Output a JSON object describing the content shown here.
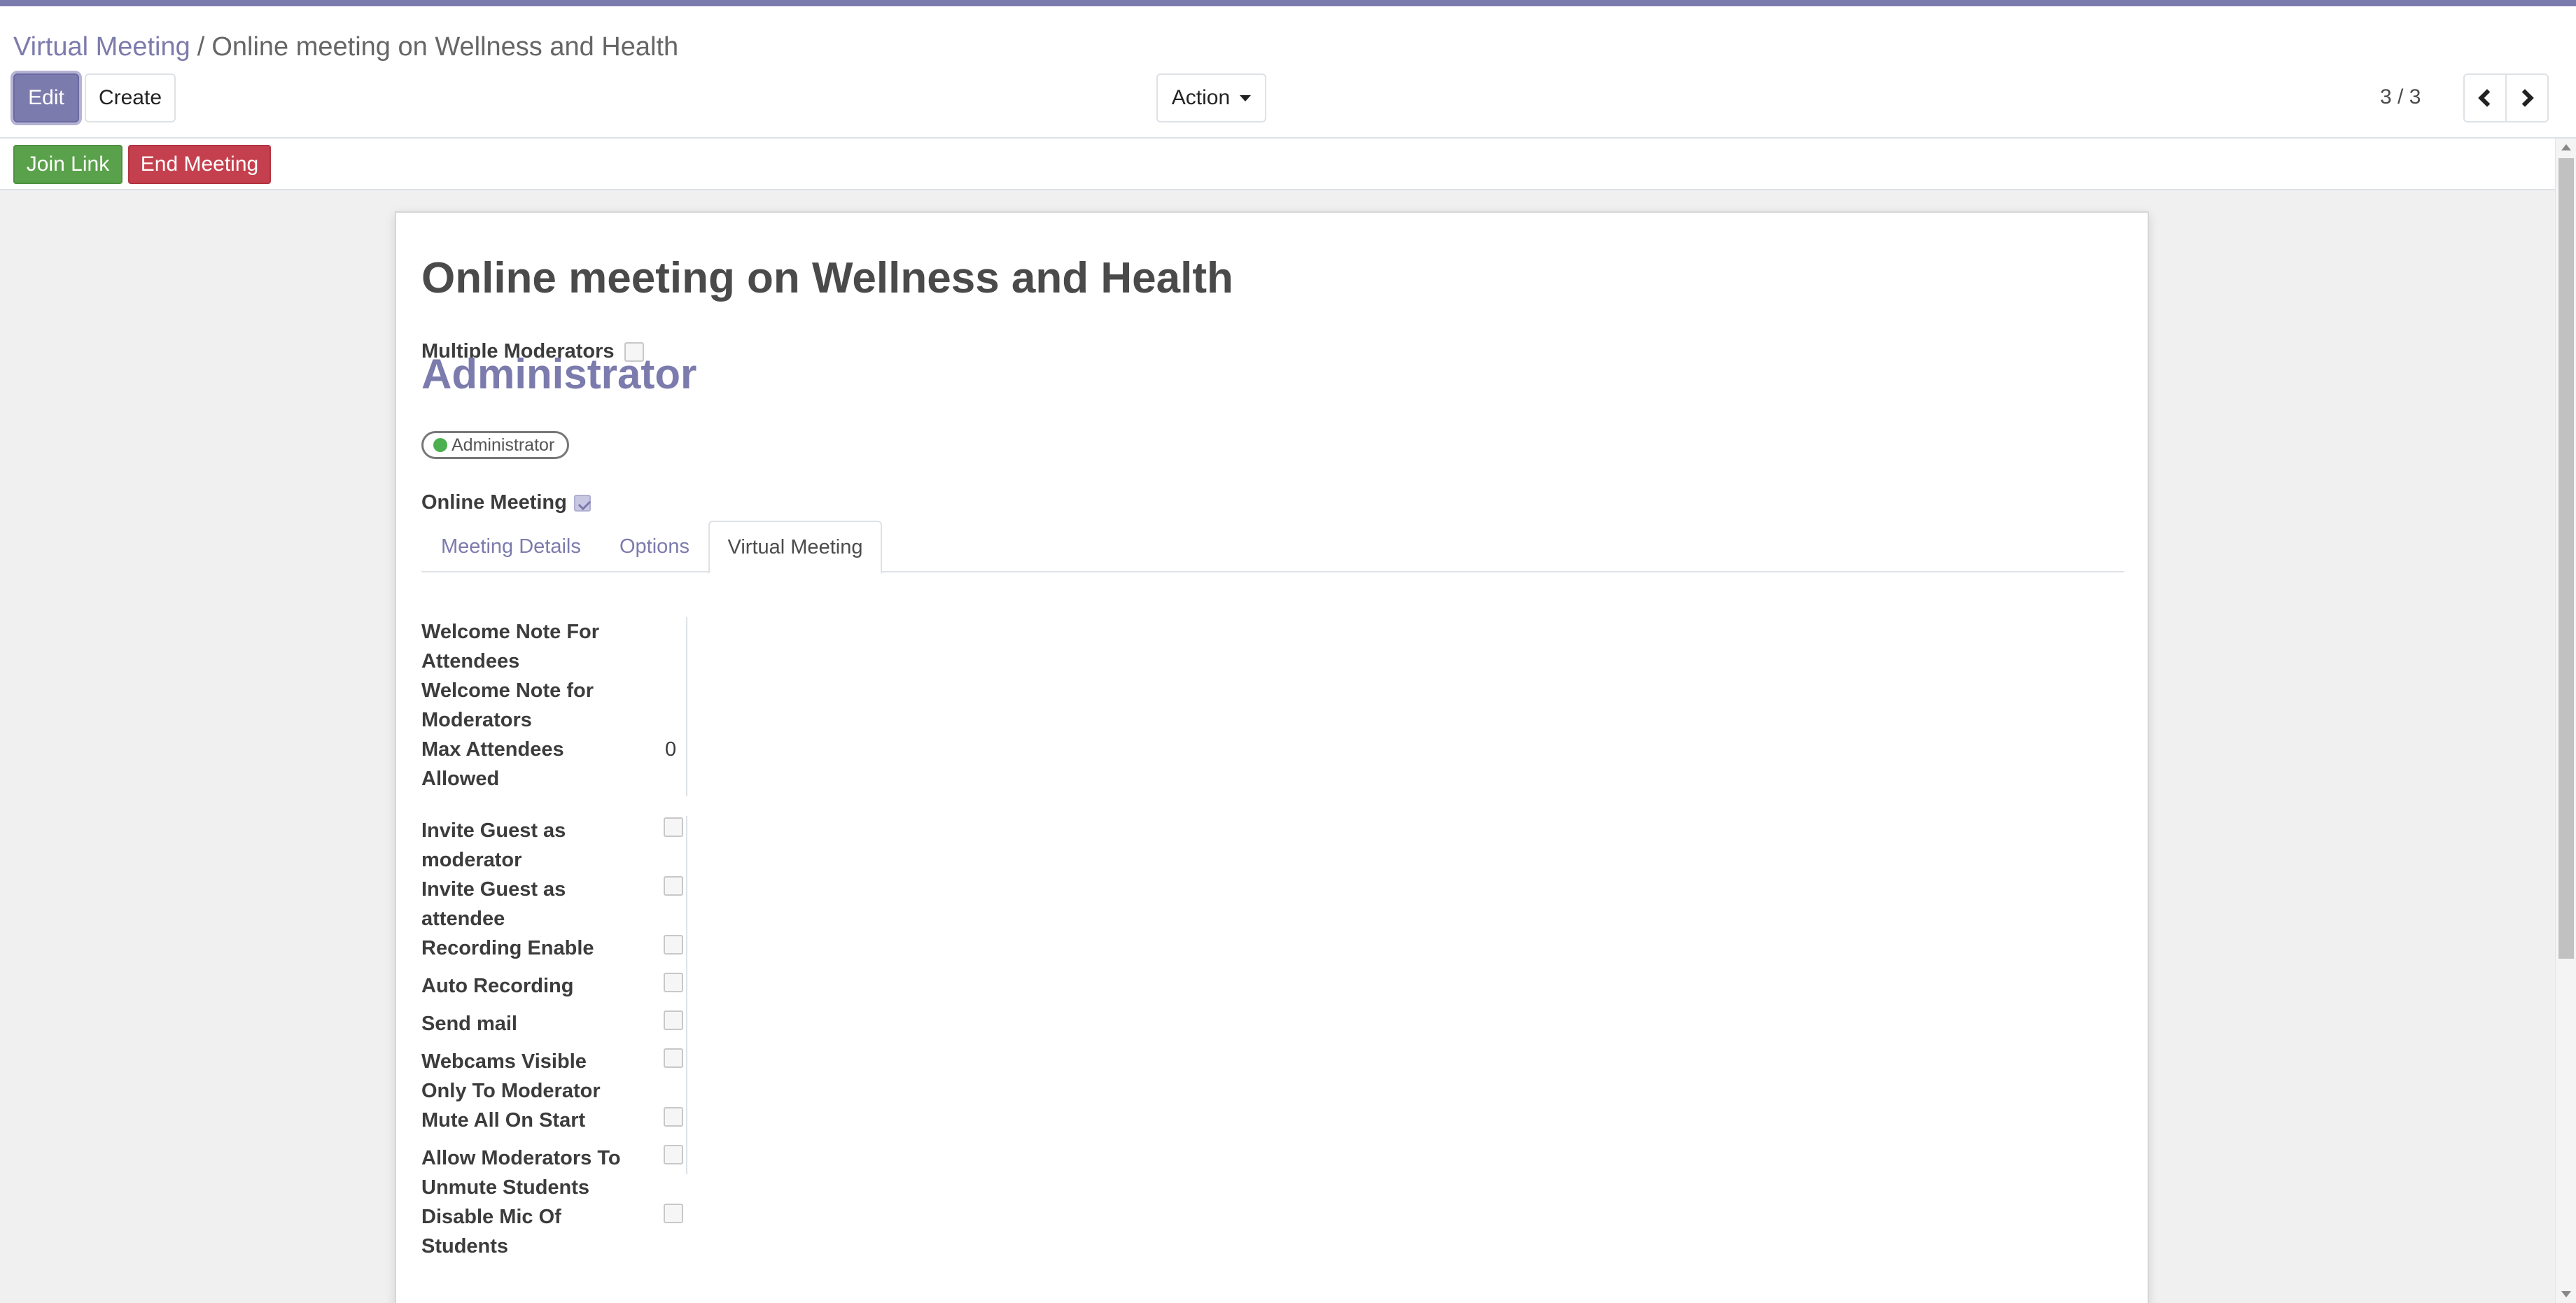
{
  "breadcrumb": {
    "parent": "Virtual Meeting",
    "separator": "/",
    "current": "Online meeting on Wellness and Health"
  },
  "toolbar": {
    "edit_label": "Edit",
    "create_label": "Create",
    "action_label": "Action"
  },
  "pager": {
    "value": "3 / 3"
  },
  "statusbar": {
    "join_label": "Join Link",
    "end_label": "End Meeting"
  },
  "form": {
    "title": "Online meeting on Wellness and Health",
    "multiple_moderators_label": "Multiple Moderators",
    "multiple_moderators": false,
    "organizer": "Administrator",
    "tag": "Administrator",
    "online_meeting_label": "Online Meeting",
    "online_meeting": true
  },
  "tabs": [
    {
      "label": "Meeting Details",
      "active": false
    },
    {
      "label": "Options",
      "active": false
    },
    {
      "label": "Virtual Meeting",
      "active": true
    }
  ],
  "virtual": {
    "welcome_attendees_label": "Welcome Note For Attendees",
    "welcome_attendees_value": "",
    "welcome_moderators_label": "Welcome Note for Moderators",
    "welcome_moderators_value": "",
    "max_attendees_label": "Max Attendees Allowed",
    "max_attendees_value": "0",
    "checkboxes": [
      {
        "label": "Invite Guest as moderator",
        "checked": false
      },
      {
        "label": "Invite Guest as attendee",
        "checked": false
      },
      {
        "label": "Recording Enable",
        "checked": false
      },
      {
        "label": "Auto Recording",
        "checked": false
      },
      {
        "label": "Send mail",
        "checked": false
      },
      {
        "label": "Webcams Visible Only To Moderator",
        "checked": false
      },
      {
        "label": "Mute All On Start",
        "checked": false
      },
      {
        "label": "Allow Moderators To Unmute Students",
        "checked": false
      },
      {
        "label": "Disable Mic Of Students",
        "checked": false
      }
    ]
  },
  "colors": {
    "brand": "#7c7bad",
    "success": "#5aa14b",
    "danger": "#c5404e"
  }
}
